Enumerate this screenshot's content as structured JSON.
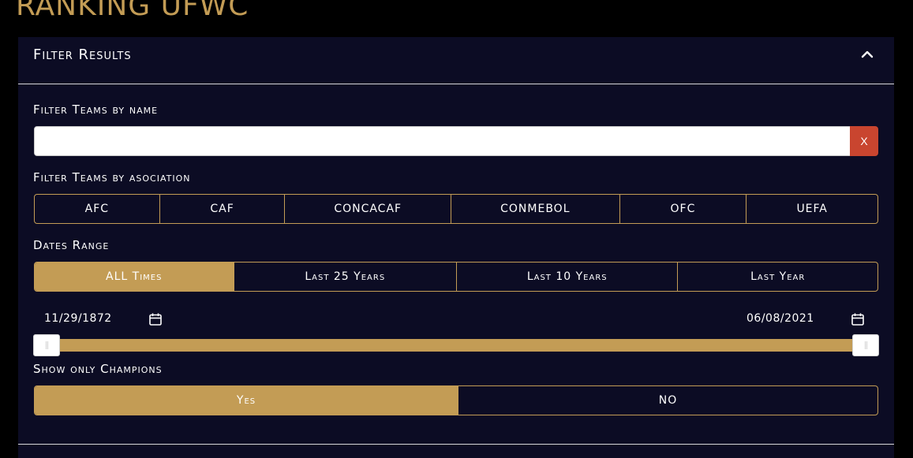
{
  "page": {
    "title": "RANKING UFWC"
  },
  "filters": {
    "header_title": "Filter Results",
    "name_label": "Filter Teams by name",
    "name_value": "",
    "clear_label": "X",
    "association_label": "Filter Teams by asociation",
    "associations": [
      "AFC",
      "CAF",
      "CONCACAF",
      "CONMEBOL",
      "OFC",
      "UEFA"
    ],
    "dates_label": "Dates Range",
    "date_ranges": [
      "ALL Times",
      "Last 25 Years",
      "Last 10 Years",
      "Last Year"
    ],
    "date_range_selected": "ALL Times",
    "start_date": "11/29/1872",
    "end_date": "06/08/2021",
    "slider_range": [
      0,
      1
    ],
    "champions_label": "Show only Champions",
    "champions_options": [
      "Yes",
      "NO"
    ],
    "champions_selected": "Yes"
  },
  "colors": {
    "accent": "#c39c55",
    "panel": "#0c0c24",
    "background": "#000000",
    "clear_button": "#c9452f"
  },
  "icons": {
    "collapse": "chevron-up-icon",
    "calendar": "calendar-icon"
  }
}
